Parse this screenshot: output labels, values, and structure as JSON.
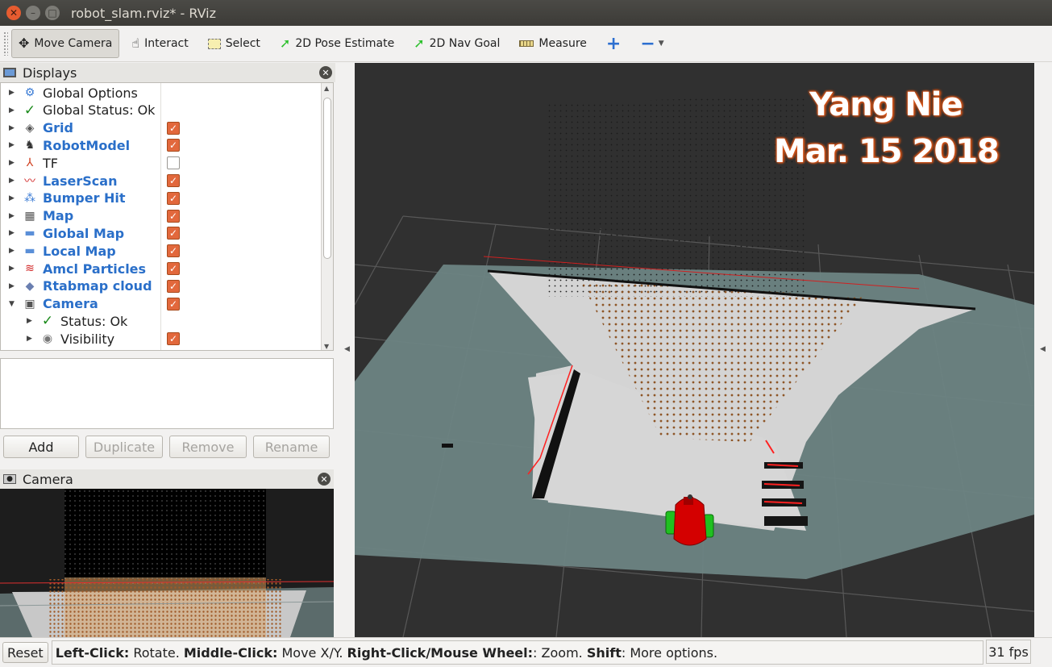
{
  "window": {
    "title": "robot_slam.rviz* - RViz"
  },
  "toolbar": {
    "tools": [
      {
        "label": "Move Camera",
        "icon": "move-camera-icon",
        "active": true
      },
      {
        "label": "Interact",
        "icon": "hand-icon"
      },
      {
        "label": "Select",
        "icon": "select-box-icon"
      },
      {
        "label": "2D Pose Estimate",
        "icon": "pose-arrow-icon"
      },
      {
        "label": "2D Nav Goal",
        "icon": "nav-goal-arrow-icon"
      },
      {
        "label": "Measure",
        "icon": "ruler-icon"
      }
    ]
  },
  "displays": {
    "title": "Displays",
    "items": [
      {
        "label": "Global Options",
        "icon": "gear-icon",
        "checked": null,
        "blue": false,
        "expanded": false
      },
      {
        "label": "Global Status: Ok",
        "icon": "checkmark-icon",
        "checked": null,
        "blue": false,
        "expanded": false
      },
      {
        "label": "Grid",
        "icon": "grid-icon",
        "checked": true,
        "blue": true,
        "expanded": false
      },
      {
        "label": "RobotModel",
        "icon": "robot-model-icon",
        "checked": true,
        "blue": true,
        "expanded": false
      },
      {
        "label": "TF",
        "icon": "tf-axes-icon",
        "checked": false,
        "blue": false,
        "expanded": false
      },
      {
        "label": "LaserScan",
        "icon": "laser-scan-icon",
        "checked": true,
        "blue": true,
        "expanded": false
      },
      {
        "label": "Bumper Hit",
        "icon": "point-cloud-icon",
        "checked": true,
        "blue": true,
        "expanded": false
      },
      {
        "label": "Map",
        "icon": "map-icon",
        "checked": true,
        "blue": true,
        "expanded": false
      },
      {
        "label": "Global Map",
        "icon": "folder-icon",
        "checked": true,
        "blue": true,
        "expanded": false
      },
      {
        "label": "Local Map",
        "icon": "folder-icon",
        "checked": true,
        "blue": true,
        "expanded": false
      },
      {
        "label": "Amcl Particles",
        "icon": "particles-icon",
        "checked": true,
        "blue": true,
        "expanded": false
      },
      {
        "label": "Rtabmap cloud",
        "icon": "cloud-diamond-icon",
        "checked": true,
        "blue": true,
        "expanded": false
      },
      {
        "label": "Camera",
        "icon": "camera-icon",
        "checked": true,
        "blue": true,
        "expanded": true
      },
      {
        "label": "Status: Ok",
        "icon": "checkmark-icon",
        "checked": null,
        "blue": false,
        "child": true
      },
      {
        "label": "Visibility",
        "icon": "eye-icon",
        "checked": true,
        "blue": false,
        "child": true
      }
    ]
  },
  "buttons": {
    "add": "Add",
    "duplicate": "Duplicate",
    "remove": "Remove",
    "rename": "Rename"
  },
  "camera_panel": {
    "title": "Camera"
  },
  "overlay": {
    "name": "Yang Nie",
    "date": "Mar. 15 2018"
  },
  "status": {
    "reset": "Reset",
    "help": [
      {
        "b": "Left-Click:",
        "t": " Rotate. "
      },
      {
        "b": "Middle-Click:",
        "t": " Move X/Y. "
      },
      {
        "b": "Right-Click/Mouse Wheel:",
        "t": ": Zoom. "
      },
      {
        "b": "Shift",
        "t": ": More options."
      }
    ],
    "fps": "31 fps"
  },
  "colors": {
    "accent_check": "#e2683c",
    "viewport_bg": "#303030",
    "map_free": "#d6d6d6",
    "map_unknown": "#6e8584",
    "robot": "#d40000",
    "laser": "#ff2020",
    "cloud": "#a0602a"
  }
}
